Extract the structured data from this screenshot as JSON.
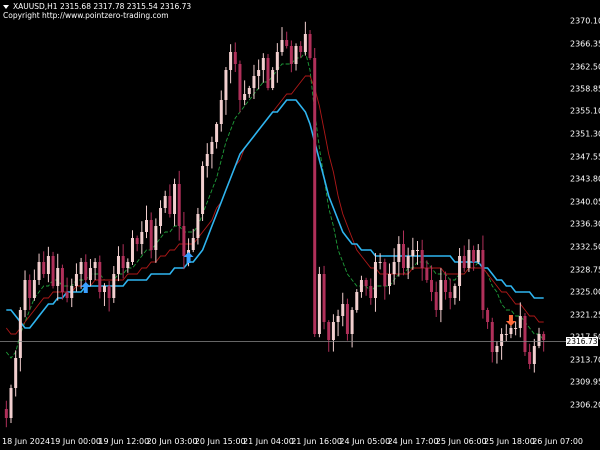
{
  "header": {
    "symbol_line": "XAUUSD,H1  2315.68 2317.78 2315.54 2316.73",
    "copyright_line": "Copyright http://www.pointzero-trading.com"
  },
  "current_price": {
    "label": "2316.73",
    "value": 2316.73
  },
  "price_axis": {
    "min": 2302,
    "max": 2372,
    "ticks": [
      "2370.10",
      "2366.35",
      "2362.50",
      "2358.85",
      "2355.10",
      "2351.30",
      "2347.55",
      "2343.80",
      "2340.05",
      "2336.30",
      "2332.50",
      "2328.75",
      "2325.00",
      "2321.25",
      "2317.50",
      "2313.70",
      "2309.95",
      "2306.20"
    ]
  },
  "time_axis": {
    "labels": [
      "18 Jun 2024",
      "19 Jun 00:00",
      "19 Jun 12:00",
      "20 Jun 03:00",
      "20 Jun 15:00",
      "21 Jun 04:00",
      "21 Jun 16:00",
      "24 Jun 05:00",
      "24 Jun 17:00",
      "25 Jun 06:00",
      "25 Jun 18:00",
      "26 Jun 07:00"
    ]
  },
  "colors": {
    "background": "#000000",
    "candle_bull": "#f2cfcf",
    "candle_bear": "#b0305a",
    "ma_fast": "#1f9e3a",
    "ma_mid": "#b01818",
    "ma_slow": "#2fb5f0",
    "arrow_up": "#3aa0ff",
    "arrow_down": "#ff6a3a",
    "grid_line": "#888888"
  },
  "chart_data": {
    "type": "candlestick",
    "title": "XAUUSD,H1",
    "ylim": [
      2302,
      2372
    ],
    "series": [
      {
        "name": "price",
        "values": [
          2304,
          2309,
          2314,
          2322,
          2327,
          2324,
          2327,
          2330,
          2328,
          2331,
          2326,
          2329,
          2325,
          2324,
          2326,
          2328,
          2330,
          2327,
          2329,
          2330,
          2325,
          2326,
          2324,
          2328,
          2331,
          2329,
          2330,
          2334,
          2333,
          2335,
          2337,
          2332,
          2336,
          2339,
          2341,
          2338,
          2343,
          2336,
          2331,
          2332,
          2334,
          2338,
          2346,
          2348,
          2350,
          2353,
          2357,
          2362,
          2365,
          2363,
          2357,
          2358,
          2359,
          2361,
          2362,
          2364,
          2359,
          2362,
          2365,
          2367,
          2366,
          2363,
          2366,
          2365,
          2368,
          2364,
          2318,
          2328,
          2320,
          2317,
          2320,
          2321,
          2323,
          2318,
          2322,
          2325,
          2327,
          2326,
          2324,
          2330,
          2330,
          2326,
          2328,
          2330,
          2333,
          2329,
          2331,
          2332,
          2332,
          2329,
          2327,
          2325,
          2322,
          2327,
          2325,
          2324,
          2326,
          2331,
          2329,
          2332,
          2330,
          2332,
          2322,
          2320,
          2315,
          2316,
          2318,
          2318,
          2319,
          2319,
          2321,
          2315,
          2313,
          2316,
          2318,
          2317
        ]
      },
      {
        "name": "fast_ma",
        "values": [
          2315,
          2314,
          2315,
          2318,
          2320,
          2322,
          2324,
          2325,
          2326,
          2326,
          2327,
          2327,
          2326,
          2326,
          2326,
          2327,
          2327,
          2327,
          2328,
          2328,
          2328,
          2327,
          2327,
          2327,
          2328,
          2328,
          2329,
          2329,
          2330,
          2331,
          2332,
          2332,
          2333,
          2334,
          2335,
          2335,
          2336,
          2336,
          2335,
          2335,
          2335,
          2336,
          2338,
          2340,
          2342,
          2344,
          2347,
          2350,
          2352,
          2354,
          2355,
          2356,
          2357,
          2358,
          2359,
          2360,
          2360,
          2361,
          2362,
          2363,
          2363,
          2363,
          2364,
          2364,
          2365,
          2362,
          2355,
          2349,
          2344,
          2339,
          2336,
          2332,
          2330,
          2328,
          2327,
          2326,
          2326,
          2326,
          2325,
          2326,
          2326,
          2326,
          2326,
          2327,
          2328,
          2328,
          2329,
          2329,
          2330,
          2330,
          2330,
          2329,
          2328,
          2328,
          2328,
          2327,
          2327,
          2328,
          2328,
          2329,
          2329,
          2330,
          2329,
          2328,
          2326,
          2325,
          2323,
          2322,
          2322,
          2321,
          2321,
          2320,
          2319,
          2318,
          2318,
          2317
        ]
      },
      {
        "name": "mid_ma",
        "values": [
          2319,
          2318,
          2318,
          2319,
          2320,
          2321,
          2322,
          2323,
          2324,
          2324,
          2325,
          2325,
          2325,
          2325,
          2325,
          2326,
          2326,
          2326,
          2326,
          2327,
          2327,
          2327,
          2327,
          2327,
          2327,
          2327,
          2328,
          2328,
          2328,
          2329,
          2329,
          2330,
          2330,
          2331,
          2331,
          2332,
          2332,
          2333,
          2333,
          2333,
          2333,
          2334,
          2335,
          2336,
          2337,
          2339,
          2340,
          2342,
          2344,
          2346,
          2347,
          2349,
          2350,
          2351,
          2352,
          2353,
          2354,
          2355,
          2356,
          2357,
          2358,
          2358,
          2359,
          2360,
          2361,
          2361,
          2359,
          2356,
          2352,
          2348,
          2345,
          2341,
          2338,
          2336,
          2334,
          2332,
          2331,
          2330,
          2329,
          2329,
          2328,
          2328,
          2328,
          2328,
          2328,
          2328,
          2328,
          2329,
          2329,
          2329,
          2329,
          2329,
          2329,
          2329,
          2328,
          2328,
          2328,
          2328,
          2328,
          2329,
          2329,
          2329,
          2329,
          2328,
          2327,
          2326,
          2325,
          2325,
          2324,
          2323,
          2323,
          2322,
          2321,
          2321,
          2320,
          2320
        ]
      },
      {
        "name": "slow_ma",
        "values": [
          2322,
          2322,
          2321,
          2320,
          2319,
          2319,
          2320,
          2321,
          2322,
          2323,
          2323,
          2324,
          2324,
          2325,
          2325,
          2325,
          2325,
          2326,
          2326,
          2326,
          2326,
          2326,
          2326,
          2326,
          2326,
          2326,
          2327,
          2327,
          2327,
          2327,
          2327,
          2328,
          2328,
          2328,
          2328,
          2328,
          2329,
          2329,
          2329,
          2330,
          2330,
          2331,
          2332,
          2334,
          2336,
          2338,
          2340,
          2342,
          2344,
          2346,
          2348,
          2349,
          2350,
          2351,
          2352,
          2353,
          2354,
          2355,
          2355,
          2356,
          2357,
          2357,
          2357,
          2356,
          2355,
          2353,
          2350,
          2347,
          2344,
          2341,
          2339,
          2337,
          2335,
          2334,
          2333,
          2333,
          2332,
          2332,
          2332,
          2331,
          2331,
          2331,
          2331,
          2331,
          2331,
          2331,
          2331,
          2331,
          2331,
          2331,
          2331,
          2331,
          2331,
          2331,
          2331,
          2331,
          2330,
          2330,
          2330,
          2330,
          2330,
          2330,
          2329,
          2329,
          2328,
          2327,
          2327,
          2326,
          2326,
          2325,
          2325,
          2325,
          2325,
          2324,
          2324,
          2324
        ]
      }
    ],
    "signals": [
      {
        "type": "buy",
        "index": 17
      },
      {
        "type": "buy",
        "index": 39
      },
      {
        "type": "sell",
        "index": 108
      }
    ]
  }
}
